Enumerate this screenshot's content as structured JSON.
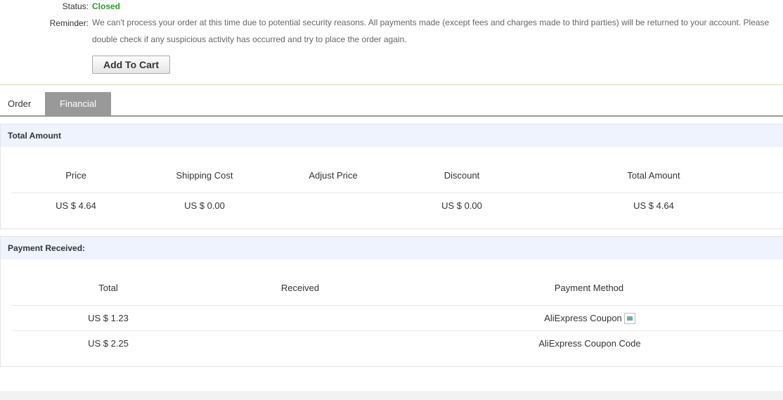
{
  "order_info": {
    "status_label": "Status:",
    "status_value": "Closed",
    "reminder_label": "Reminder:",
    "reminder_text": "We can't process your order at this time due to potential security reasons. All payments made (except fees and charges made to third parties) will be returned to your account. Please double check if any suspicious activity has occurred and try to place the order again.",
    "add_to_cart_label": "Add To Cart"
  },
  "tabs": [
    {
      "label": "Order",
      "active": false
    },
    {
      "label": "Financial",
      "active": true
    }
  ],
  "total_amount": {
    "title": "Total Amount",
    "headers": [
      "Price",
      "Shipping Cost",
      "Adjust Price",
      "Discount",
      "Total Amount"
    ],
    "row": [
      "US $ 4.64",
      "US $ 0.00",
      "",
      "US $ 0.00",
      "US $ 4.64"
    ]
  },
  "payment_received": {
    "title": "Payment Received:",
    "headers": [
      "Total",
      "Received",
      "Payment Method"
    ],
    "rows": [
      {
        "total": "US $ 1.23",
        "received": "",
        "method": "AliExpress Coupon",
        "method_icon": "broken-image-icon"
      },
      {
        "total": "US $ 2.25",
        "received": "",
        "method": "AliExpress Coupon Code"
      }
    ]
  },
  "colors": {
    "status_green": "#2a9f27",
    "active_tab_bg": "#999999",
    "panel_header_bg": "#eef3fd",
    "separator": "#e8dcb6"
  }
}
